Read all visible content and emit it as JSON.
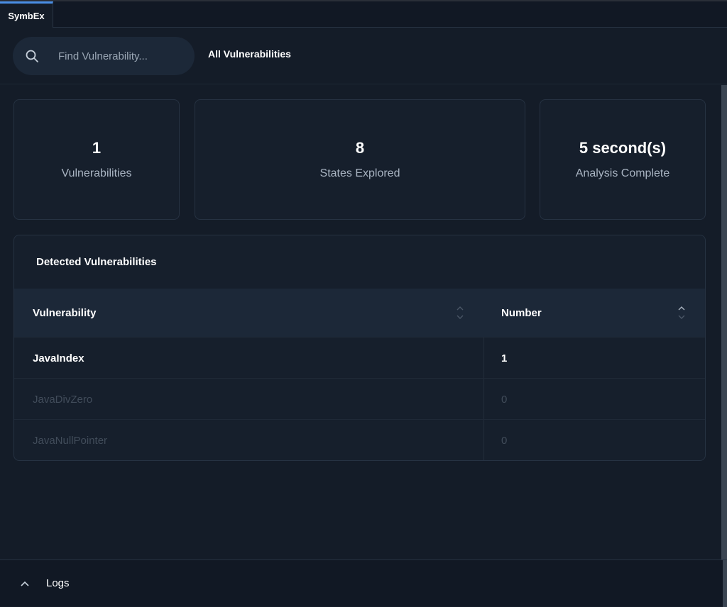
{
  "tabbar": {
    "tabs": [
      {
        "label": "SymbEx",
        "active": true
      }
    ]
  },
  "header": {
    "search": {
      "placeholder": "Find Vulnerability...",
      "value": "",
      "icon": "search-icon"
    },
    "filter_label": "All Vulnerabilities"
  },
  "stats": [
    {
      "value": "1",
      "label": "Vulnerabilities"
    },
    {
      "value": "8",
      "label": "States Explored"
    },
    {
      "value": "5 second(s)",
      "label": "Analysis Complete"
    }
  ],
  "table": {
    "title": "Detected Vulnerabilities",
    "columns": [
      "Vulnerability",
      "Number"
    ],
    "rows": [
      {
        "name": "JavaIndex",
        "number": "1"
      },
      {
        "name": "JavaDivZero",
        "number": "0"
      },
      {
        "name": "JavaNullPointer",
        "number": "0"
      }
    ]
  },
  "logs": {
    "label": "Logs",
    "icon": "chevron-up-icon"
  },
  "colors": {
    "accent": "#4a8fe7",
    "background": "#141c28",
    "card": "#161f2c",
    "header_row": "#1c2838"
  }
}
